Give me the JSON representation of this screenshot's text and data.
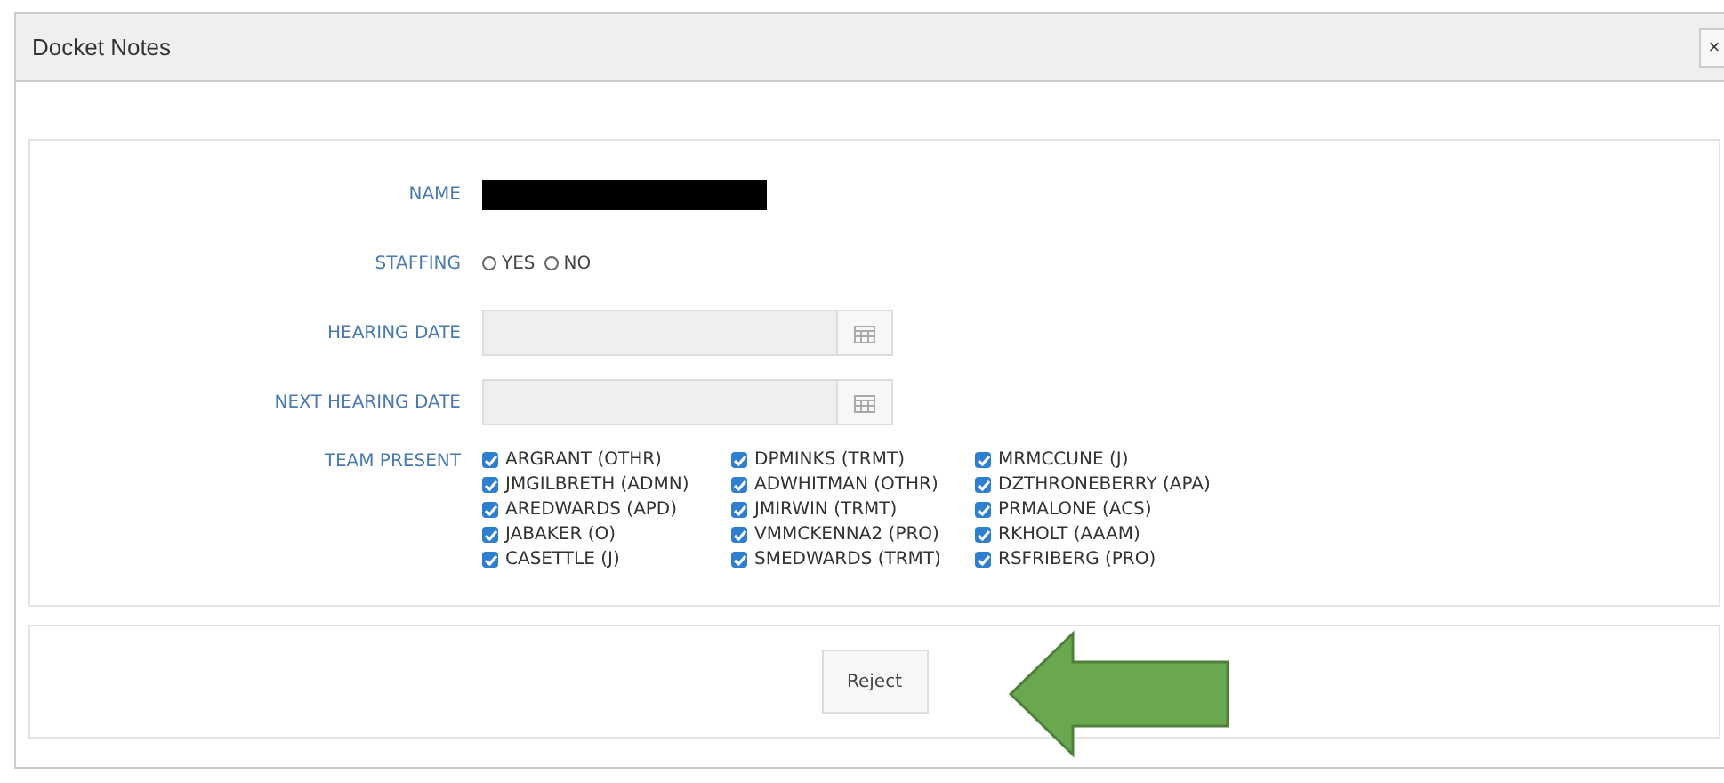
{
  "window": {
    "title": "Docket Notes",
    "close": "×"
  },
  "form": {
    "name": {
      "label": "NAME"
    },
    "staffing": {
      "label": "STAFFING",
      "options": [
        {
          "label": "YES",
          "selected": false
        },
        {
          "label": "NO",
          "selected": false
        }
      ]
    },
    "dates": [
      {
        "label": "HEARING DATE"
      },
      {
        "label": "NEXT HEARING DATE"
      }
    ],
    "team": {
      "label": "TEAM PRESENT",
      "members": [
        {
          "label": "ARGRANT (OTHR)",
          "checked": true
        },
        {
          "label": "DPMINKS (TRMT)",
          "checked": true
        },
        {
          "label": "MRMCCUNE (J)",
          "checked": true
        },
        {
          "label": "JMGILBRETH (ADMN)",
          "checked": true
        },
        {
          "label": "ADWHITMAN (OTHR)",
          "checked": true
        },
        {
          "label": "DZTHRONEBERRY (APA)",
          "checked": true
        },
        {
          "label": "AREDWARDS (APD)",
          "checked": true
        },
        {
          "label": "JMIRWIN (TRMT)",
          "checked": true
        },
        {
          "label": "PRMALONE (ACS)",
          "checked": true
        },
        {
          "label": "JABAKER (O)",
          "checked": true
        },
        {
          "label": "VMMCKENNA2 (PRO)",
          "checked": true
        },
        {
          "label": "RKHOLT (AAAM)",
          "checked": true
        },
        {
          "label": "CASETTLE (J)",
          "checked": true
        },
        {
          "label": "SMEDWARDS (TRMT)",
          "checked": true
        },
        {
          "label": "RSFRIBERG (PRO)",
          "checked": true
        }
      ]
    }
  },
  "footer": {
    "button": "Reject"
  }
}
